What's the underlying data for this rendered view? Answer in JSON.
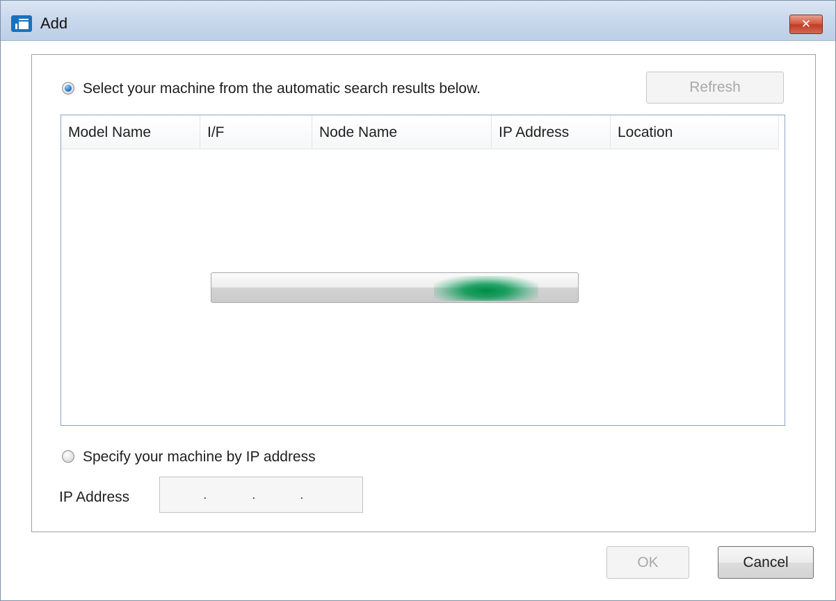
{
  "window": {
    "title": "Add",
    "close_label": "✕"
  },
  "auto_search": {
    "radio_label": "Select your machine from the automatic search results  below.",
    "selected": true,
    "refresh_label": "Refresh"
  },
  "results_table": {
    "columns": [
      "Model Name",
      "I/F",
      "Node Name",
      "IP Address",
      "Location"
    ],
    "rows": []
  },
  "progress": {
    "state": "searching",
    "accent": "#009a4e"
  },
  "manual_ip": {
    "radio_label": "Specify your machine by IP address",
    "selected": false,
    "field_label": "IP Address",
    "separators": [
      ".",
      ".",
      "."
    ],
    "value": ""
  },
  "footer": {
    "ok_label": "OK",
    "cancel_label": "Cancel"
  },
  "icons": {
    "app": "printer-window-icon",
    "close": "close-icon"
  }
}
